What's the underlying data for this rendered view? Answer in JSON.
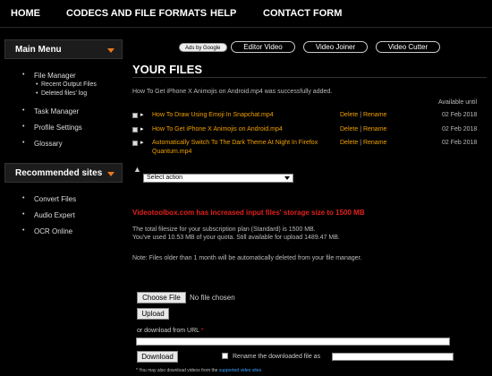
{
  "nav": {
    "items": [
      "HOME",
      "CODECS AND FILE FORMATS",
      "HELP",
      "CONTACT FORM"
    ]
  },
  "sidebar": {
    "main_menu_title": "Main Menu",
    "main_items": [
      {
        "label": "File Manager",
        "children": [
          "Recent Output Files",
          "Deleted files' log"
        ]
      },
      {
        "label": "Task Manager"
      },
      {
        "label": "Profile Settings"
      },
      {
        "label": "Glossary"
      }
    ],
    "recommended_title": "Recommended sites",
    "recommended_items": [
      "Convert Files",
      "Audio Expert",
      "OCR Online"
    ]
  },
  "ads": {
    "label": "Ads by Google",
    "pills": [
      "Editor Video",
      "Video Joiner",
      "Video Cutter"
    ]
  },
  "main": {
    "title": "YOUR FILES",
    "added_msg": "How To Get iPhone X Animojis on Android.mp4 was successfully added.",
    "available_header": "Available until",
    "files": [
      {
        "name": "How To Draw Using Emoji In Snapchat.mp4",
        "delete": "Delete",
        "rename": "Rename",
        "date": "02 Feb 2018"
      },
      {
        "name": "How To Get iPhone X Animojis on Android.mp4",
        "delete": "Delete",
        "rename": "Rename",
        "date": "02 Feb 2018"
      },
      {
        "name_line1": "Automatically Switch To The Dark Theme At Night In Firefox",
        "name_line2": "Quantum.mp4",
        "delete": "Delete",
        "rename": "Rename",
        "date": "02 Feb 2018"
      }
    ],
    "select_action": "Select action",
    "storage_warning": "Videotoolbox.com has increased input files' storage size to 1500 MB",
    "quota_line1": "The total filesize for your subscription plan (Standard) is 1500 MB.",
    "quota_line2": "You've used 10.53 MB of your quota. Still available for upload 1489.47 MB.",
    "note": "Note: Files older than 1 month will be automatically deleted from your file manager.",
    "choose_file": "Choose File",
    "no_file": "No file chosen",
    "upload": "Upload",
    "download_url_label": "or download from URL",
    "required_mark": "*",
    "download_btn": "Download",
    "rename_label": "Rename the downloaded file as",
    "footnote_prefix": "* You may also download videos from the",
    "footnote_link": "supported video sites"
  },
  "colors": {
    "accent_orange": "#e8781e",
    "link_orange": "#f0a000",
    "warning_red": "#e0201c"
  }
}
